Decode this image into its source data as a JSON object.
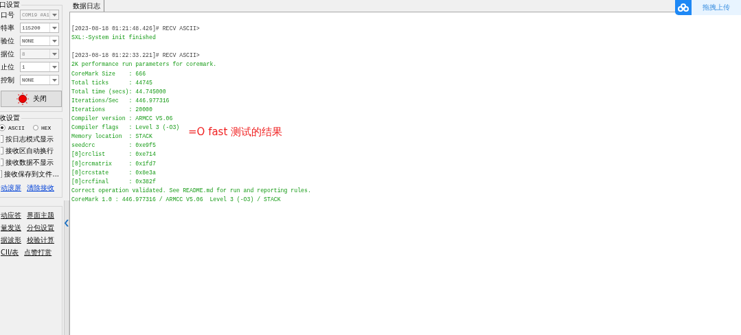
{
  "serial_settings": {
    "title": "口设置",
    "fields": [
      {
        "label": "口号",
        "value": "COM19 #A1",
        "disabled": true
      },
      {
        "label": "特率",
        "value": "115200",
        "disabled": false
      },
      {
        "label": "验位",
        "value": "NONE",
        "disabled": false
      },
      {
        "label": "据位",
        "value": "8",
        "disabled": true
      },
      {
        "label": "止位",
        "value": "1",
        "disabled": false
      },
      {
        "label": "控制",
        "value": "NONE",
        "disabled": false
      }
    ],
    "open_button": {
      "label": "关闭",
      "on": true
    }
  },
  "receive_settings": {
    "title": "收设置",
    "modes": [
      {
        "label": "ASCII",
        "selected": true
      },
      {
        "label": "HEX",
        "selected": false
      }
    ],
    "options": [
      {
        "label": "按日志模式显示",
        "checked": false
      },
      {
        "label": "接收区自动换行",
        "checked": false
      },
      {
        "label": "接收数据不显示",
        "checked": false
      },
      {
        "label": "接收保存到文件...",
        "checked": false
      }
    ],
    "links": [
      "动滚屏",
      "清除接收"
    ]
  },
  "tools": [
    [
      "动应答",
      "界面主题"
    ],
    [
      "量发送",
      "分包设置"
    ],
    [
      "据波形",
      "校验计算"
    ],
    [
      "CII/表",
      "点赞打赏"
    ]
  ],
  "tabs": [
    {
      "label": "数据日志",
      "selected": true
    }
  ],
  "log": [
    {
      "kind": "blank"
    },
    {
      "kind": "header",
      "text": "[2023-08-18 01:21:48.426]# RECV ASCII>"
    },
    {
      "kind": "data",
      "text": "SXL:-System init finished"
    },
    {
      "kind": "blank"
    },
    {
      "kind": "header",
      "text": "[2023-08-18 01:22:33.221]# RECV ASCII>"
    },
    {
      "kind": "data",
      "text": "2K performance run parameters for coremark."
    },
    {
      "kind": "data",
      "text": "CoreMark Size    : 666"
    },
    {
      "kind": "data",
      "text": "Total ticks      : 44745"
    },
    {
      "kind": "data",
      "text": "Total time (secs): 44.745000"
    },
    {
      "kind": "data",
      "text": "Iterations/Sec   : 446.977316"
    },
    {
      "kind": "data",
      "text": "Iterations       : 20000"
    },
    {
      "kind": "data",
      "text": "Compiler version : ARMCC V5.06"
    },
    {
      "kind": "data",
      "text": "Compiler flags   : Level 3 (-O3)"
    },
    {
      "kind": "data",
      "text": "Memory location  : STACK"
    },
    {
      "kind": "data",
      "text": "seedcrc          : 0xe9f5"
    },
    {
      "kind": "data",
      "text": "[0]crclist       : 0xe714"
    },
    {
      "kind": "data",
      "text": "[0]crcmatrix     : 0x1fd7"
    },
    {
      "kind": "data",
      "text": "[0]crcstate      : 0x8e3a"
    },
    {
      "kind": "data",
      "text": "[0]crcfinal      : 0x382f"
    },
    {
      "kind": "data",
      "text": "Correct operation validated. See README.md for run and reporting rules."
    },
    {
      "kind": "data",
      "text": "CoreMark 1.0 : 446.977316 / ARMCC V5.06  Level 3 (-O3) / STACK"
    }
  ],
  "annotation": "=O fast 测试的结果",
  "upload_button": {
    "label": "拖拽上传"
  }
}
